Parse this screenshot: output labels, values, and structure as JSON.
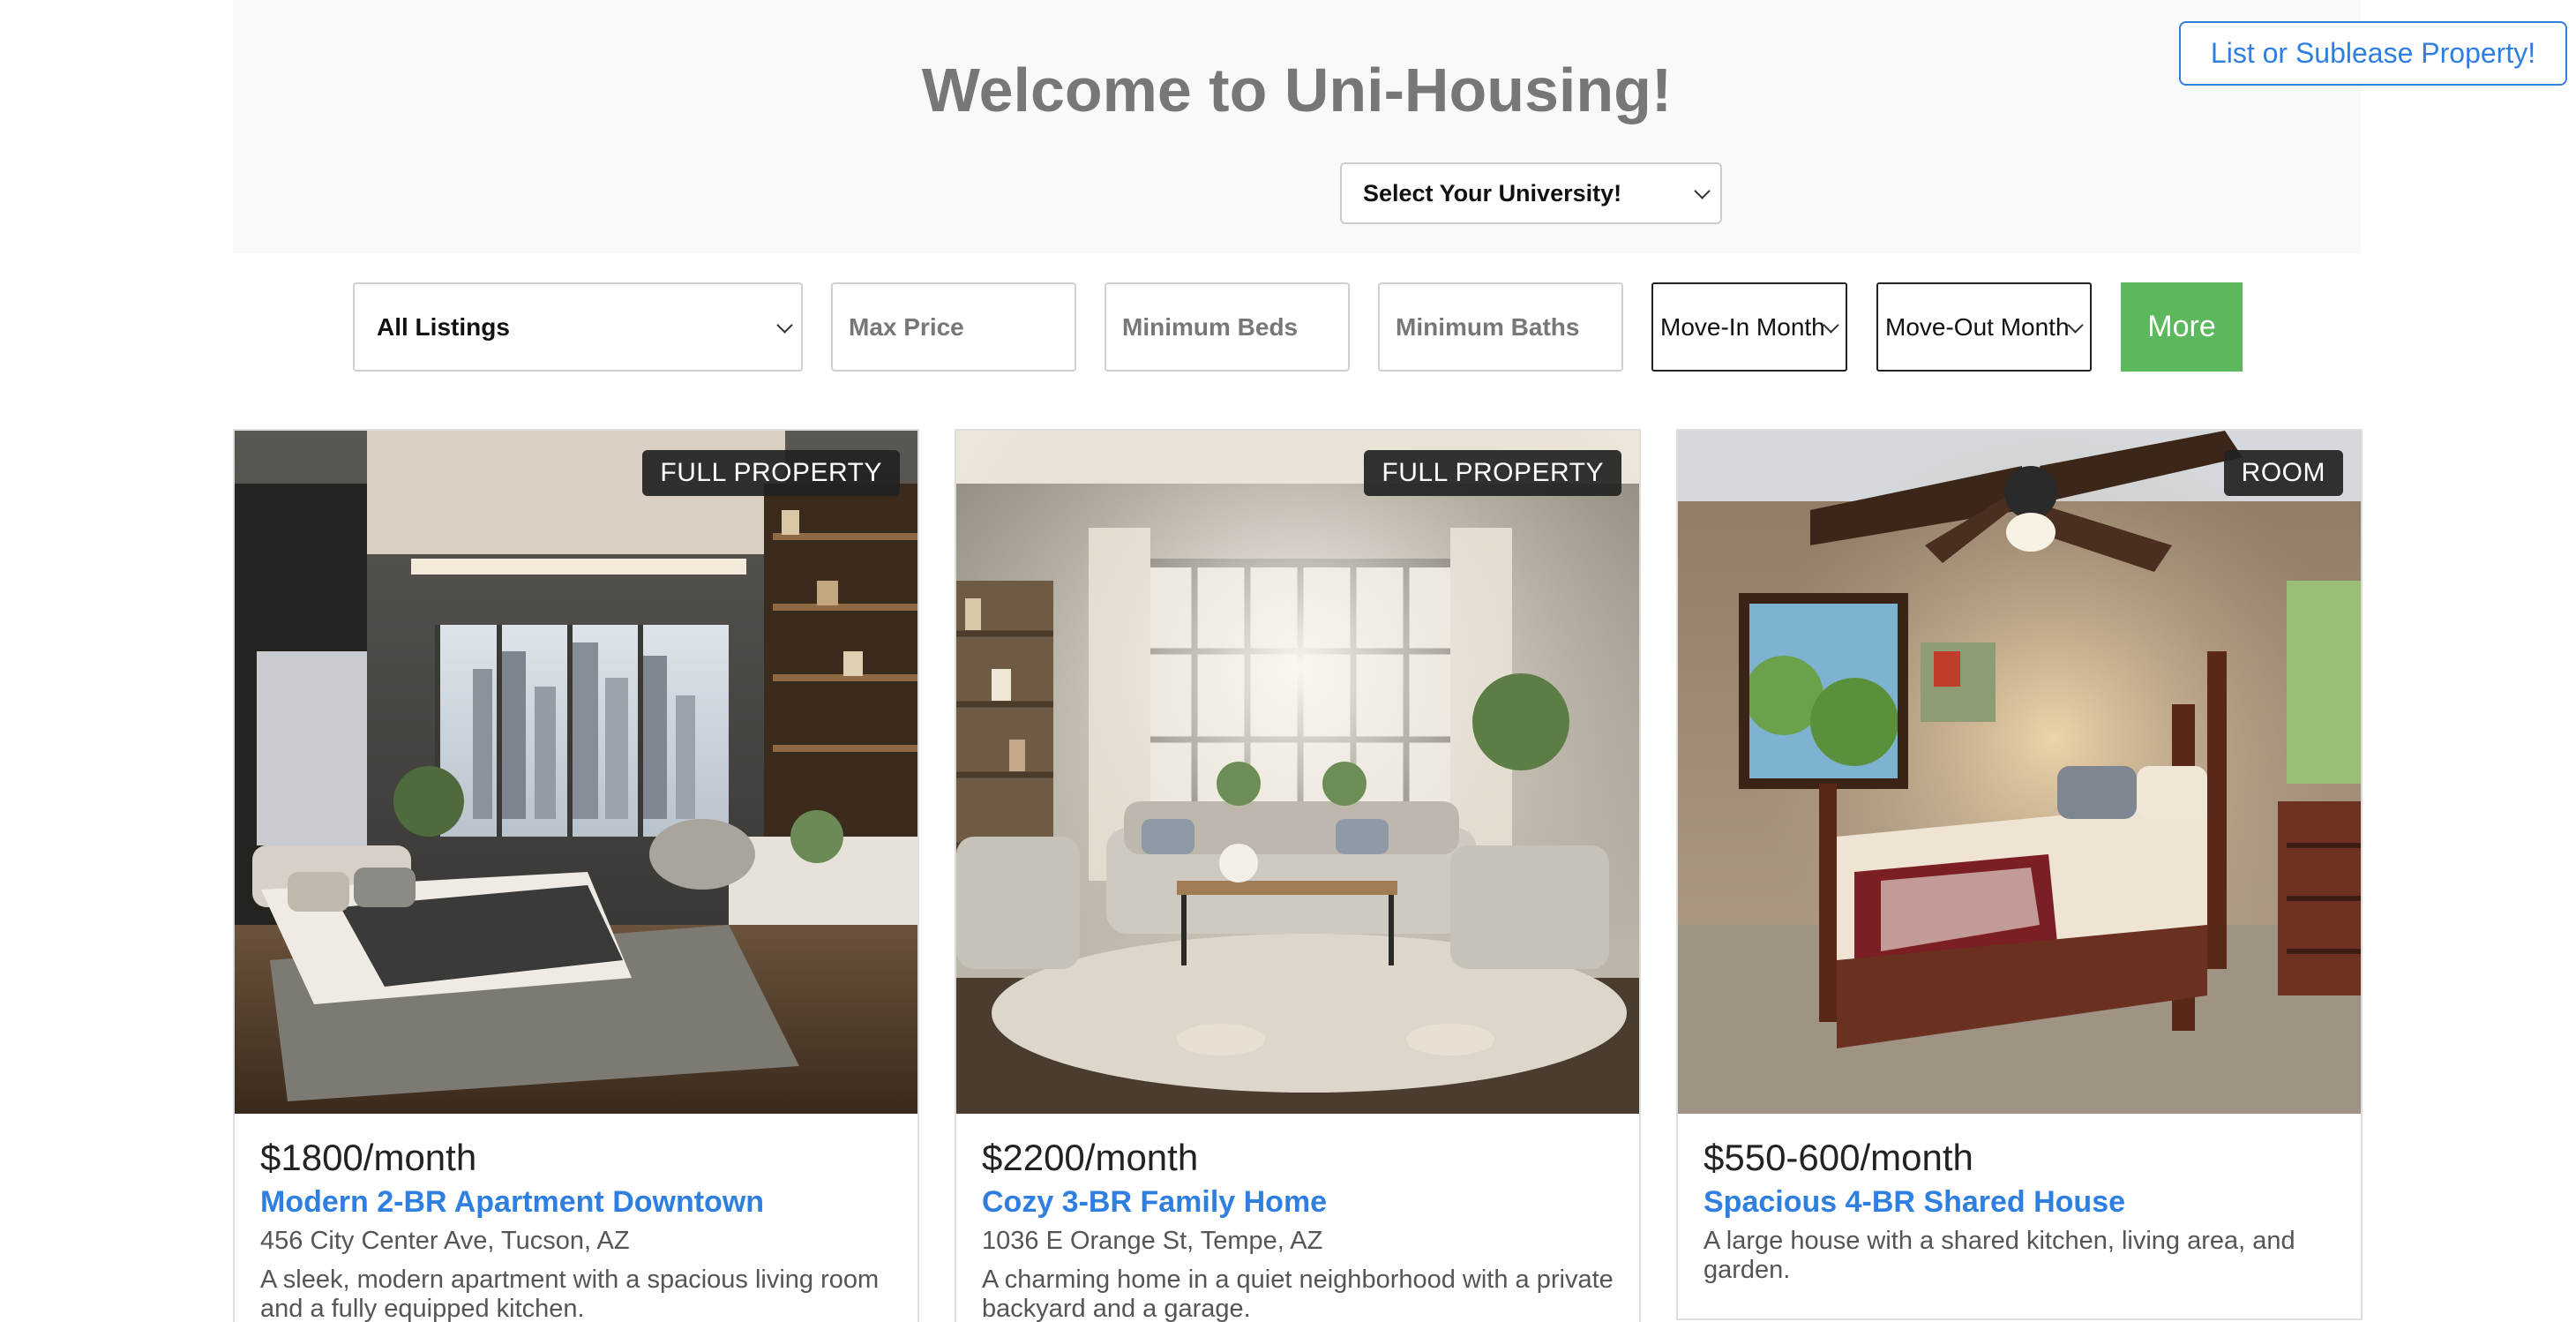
{
  "header": {
    "title": "Welcome to Uni-Housing!",
    "list_button": "List or Sublease Property!",
    "university_select": "Select Your University!"
  },
  "filters": {
    "listing_type": "All Listings",
    "max_price_placeholder": "Max Price",
    "min_beds_placeholder": "Minimum Beds",
    "min_baths_placeholder": "Minimum Baths",
    "move_in": "Move-In Month",
    "move_out": "Move-Out Month",
    "more_button": "More"
  },
  "listings": [
    {
      "badge": "FULL PROPERTY",
      "price": "$1800/month",
      "title": "Modern 2-BR Apartment Downtown",
      "address": "456 City Center Ave, Tucson, AZ",
      "description": "A sleek, modern apartment with a spacious living room and a fully equipped kitchen."
    },
    {
      "badge": "FULL PROPERTY",
      "price": "$2200/month",
      "title": "Cozy 3-BR Family Home",
      "address": "1036 E Orange St, Tempe, AZ",
      "description": "A charming home in a quiet neighborhood with a private backyard and a garage."
    },
    {
      "badge": "ROOM",
      "price": "$550-600/month",
      "title": "Spacious 4-BR Shared House",
      "address": "",
      "description": "A large house with a shared kitchen, living area, and garden."
    }
  ],
  "colors": {
    "accent_blue": "#2f7fe0",
    "more_green": "#5cb85c",
    "hero_bg": "#f8f9fa"
  }
}
